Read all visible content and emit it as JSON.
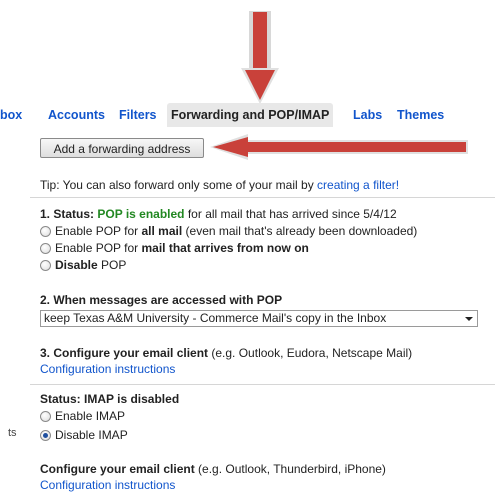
{
  "tabs": [
    {
      "label": "box"
    },
    {
      "label": "Accounts"
    },
    {
      "label": "Filters"
    },
    {
      "label": "Forwarding and POP/IMAP"
    },
    {
      "label": "Labs"
    },
    {
      "label": "Themes"
    }
  ],
  "forwarding": {
    "add_button": "Add a forwarding address",
    "tip_text": "Tip: You can also forward only some of your mail by ",
    "tip_link": "creating a filter!"
  },
  "pop": {
    "status_prefix": "1. Status: ",
    "status_value": "POP is enabled",
    "status_suffix": " for all mail that has arrived since 5/4/12",
    "opt1_a": "Enable POP for ",
    "opt1_b": "all mail",
    "opt1_c": " (even mail that's already been downloaded)",
    "opt2_a": "Enable POP for ",
    "opt2_b": "mail that arrives from now on",
    "opt3_a": "Disable",
    "opt3_b": " POP",
    "access_heading": "2. When messages are accessed with POP",
    "access_selected": "keep Texas A&M University - Commerce Mail's copy in the Inbox",
    "configure_heading": "3. Configure your email client",
    "configure_hint": " (e.g. Outlook, Eudora, Netscape Mail)",
    "configure_link": "Configuration instructions"
  },
  "imap": {
    "side_label": "ts",
    "status": "Status: IMAP is disabled",
    "enable_label": "Enable IMAP",
    "disable_label": "Disable IMAP",
    "configure_heading": "Configure your email client",
    "configure_hint": " (e.g. Outlook, Thunderbird, iPhone)",
    "configure_link": "Configuration instructions"
  },
  "colors": {
    "link": "#1155cc",
    "status_green": "#228822",
    "arrow": "#c0392b"
  },
  "icons": [
    "arrow-down-annotation",
    "arrow-left-annotation",
    "radio-button",
    "dropdown-caret"
  ]
}
